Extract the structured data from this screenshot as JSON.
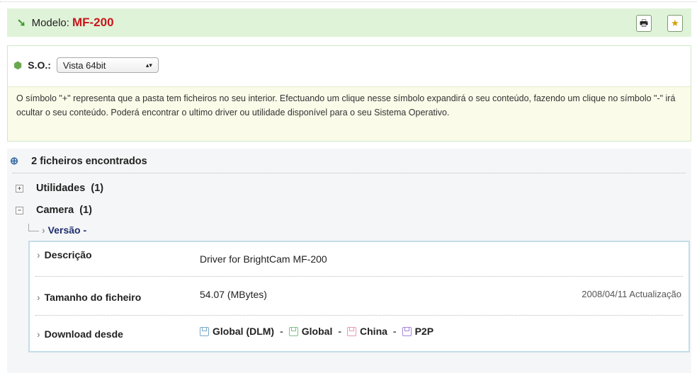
{
  "header": {
    "label": "Modelo:",
    "model": "MF-200"
  },
  "os": {
    "label": "S.O.:",
    "selected": "Vista 64bit"
  },
  "info_text": "O símbolo \"+\" representa que a pasta tem ficheiros no seu interior. Efectuando um clique nesse símbolo expandirá o seu conteúdo, fazendo um clique no símbolo \"-\" irá ocultar o seu conteúdo. Poderá encontrar o ultimo driver ou utilidade disponível para o seu Sistema Operativo.",
  "results": {
    "found": "2 ficheiros encontrados",
    "categories": [
      {
        "name": "Utilidades",
        "count": "(1)",
        "toggle": "+"
      },
      {
        "name": "Camera",
        "count": "(1)",
        "toggle": "−"
      }
    ],
    "version": "Versão -",
    "details": {
      "desc_label": "Descrição",
      "desc_value": "Driver for BrightCam MF-200",
      "size_label": "Tamanho do ficheiro",
      "size_value": "54.07 (MBytes)",
      "date": "2008/04/11 Actualização",
      "download_label": "Download desde",
      "links": [
        {
          "label": "Global (DLM)",
          "color": "#7aa8c8"
        },
        {
          "label": "Global",
          "color": "#7fc08a"
        },
        {
          "label": "China",
          "color": "#e89ab0"
        },
        {
          "label": "P2P",
          "color": "#a584d8"
        }
      ],
      "separator": "-"
    }
  }
}
